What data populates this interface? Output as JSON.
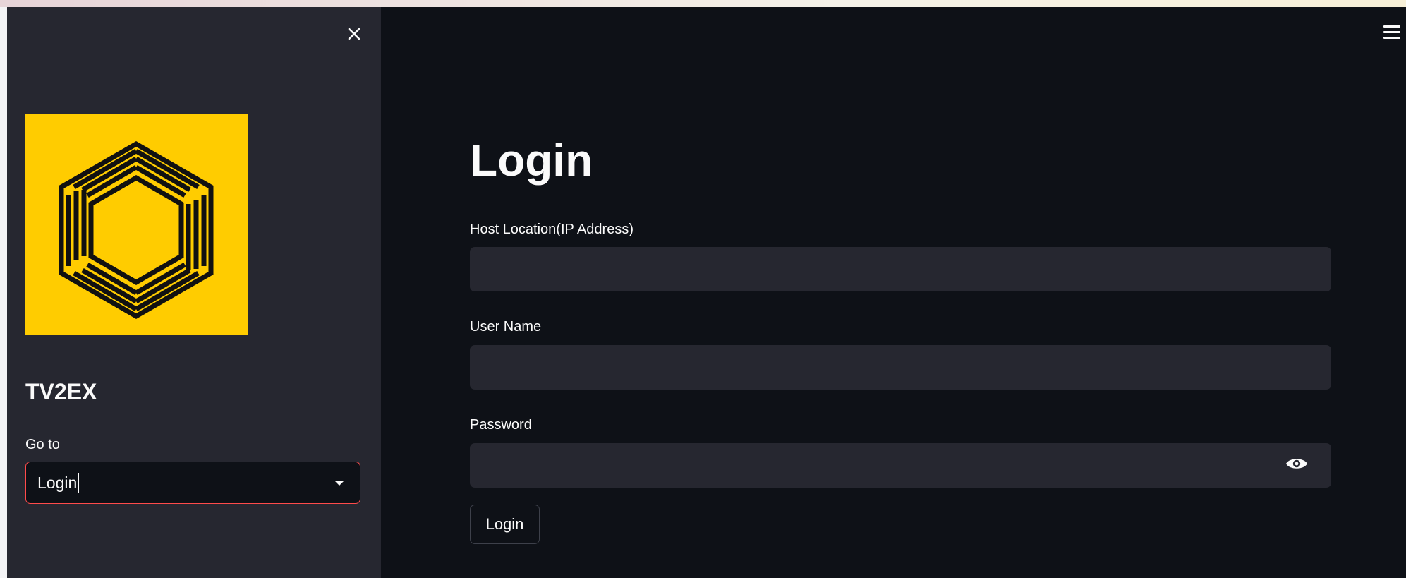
{
  "sidebar": {
    "close_icon": "close-icon",
    "logo_icon": "hexagon-lines-logo",
    "logo_color": "#ffcc00",
    "brand_title": "TV2EX",
    "goto_label": "Go to",
    "goto_selected": "Login",
    "dropdown_icon": "chevron-down-icon"
  },
  "main": {
    "menu_icon": "hamburger-menu-icon",
    "title": "Login",
    "fields": [
      {
        "label": "Host Location(IP Address)",
        "value": "",
        "placeholder": ""
      },
      {
        "label": "User Name",
        "value": "",
        "placeholder": ""
      },
      {
        "label": "Password",
        "value": "",
        "placeholder": "",
        "toggle_icon": "eye-icon"
      }
    ],
    "login_button": "Login"
  },
  "colors": {
    "sidebar_bg": "#262730",
    "main_bg": "#0e1117",
    "input_bg": "#262730",
    "focus_border": "#ff4b4b",
    "text": "#fafafa"
  }
}
